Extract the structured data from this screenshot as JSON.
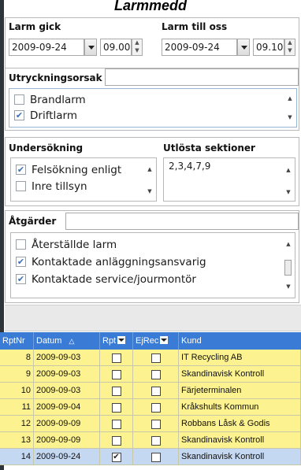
{
  "window": {
    "title": "Larmmedd"
  },
  "larm_gick": {
    "label": "Larm gick",
    "date": "2009-09-24",
    "time": "09.00"
  },
  "larm_till_oss": {
    "label": "Larm till oss",
    "date": "2009-09-24",
    "time": "09.10"
  },
  "utryckningsorsak": {
    "label": "Utryckningsorsak",
    "value": "",
    "options": [
      {
        "label": "Brandlarm",
        "checked": false
      },
      {
        "label": "Driftlarm",
        "checked": true
      }
    ]
  },
  "undersokning": {
    "label": "Undersökning",
    "options": [
      {
        "label": "Felsökning enligt",
        "checked": true
      },
      {
        "label": "Inre tillsyn",
        "checked": false
      }
    ]
  },
  "utlosta_sektioner": {
    "label": "Utlösta sektioner",
    "value": "2,3,4,7,9"
  },
  "atgarder": {
    "label": "Åtgärder",
    "value": "",
    "options": [
      {
        "label": "Återställde larm",
        "checked": false
      },
      {
        "label": "Kontaktade anläggningsansvarig",
        "checked": true
      },
      {
        "label": "Kontaktade service/jourmontör",
        "checked": true
      }
    ]
  },
  "grid": {
    "columns": [
      "RptNr",
      "Datum",
      "Rpt",
      "EjRec",
      "Kund"
    ],
    "sort_indicator": "△",
    "colors": {
      "header": "#3a7bd5",
      "row": "#fcf290",
      "row_selected": "#c5d8f2"
    },
    "rows": [
      {
        "rptnr": "8",
        "datum": "2009-09-03",
        "rpt": false,
        "ejrec": false,
        "kund": "IT Recycling AB"
      },
      {
        "rptnr": "9",
        "datum": "2009-09-03",
        "rpt": false,
        "ejrec": false,
        "kund": "Skandinavisk Kontroll"
      },
      {
        "rptnr": "10",
        "datum": "2009-09-03",
        "rpt": false,
        "ejrec": false,
        "kund": "Färjeterminalen"
      },
      {
        "rptnr": "11",
        "datum": "2009-09-04",
        "rpt": false,
        "ejrec": false,
        "kund": "Kråkshults Kommun"
      },
      {
        "rptnr": "12",
        "datum": "2009-09-09",
        "rpt": false,
        "ejrec": false,
        "kund": "Robbans Låsk & Godis"
      },
      {
        "rptnr": "13",
        "datum": "2009-09-09",
        "rpt": false,
        "ejrec": false,
        "kund": "Skandinavisk Kontroll"
      },
      {
        "rptnr": "14",
        "datum": "2009-09-24",
        "rpt": true,
        "ejrec": false,
        "kund": "Skandinavisk Kontroll"
      }
    ]
  }
}
